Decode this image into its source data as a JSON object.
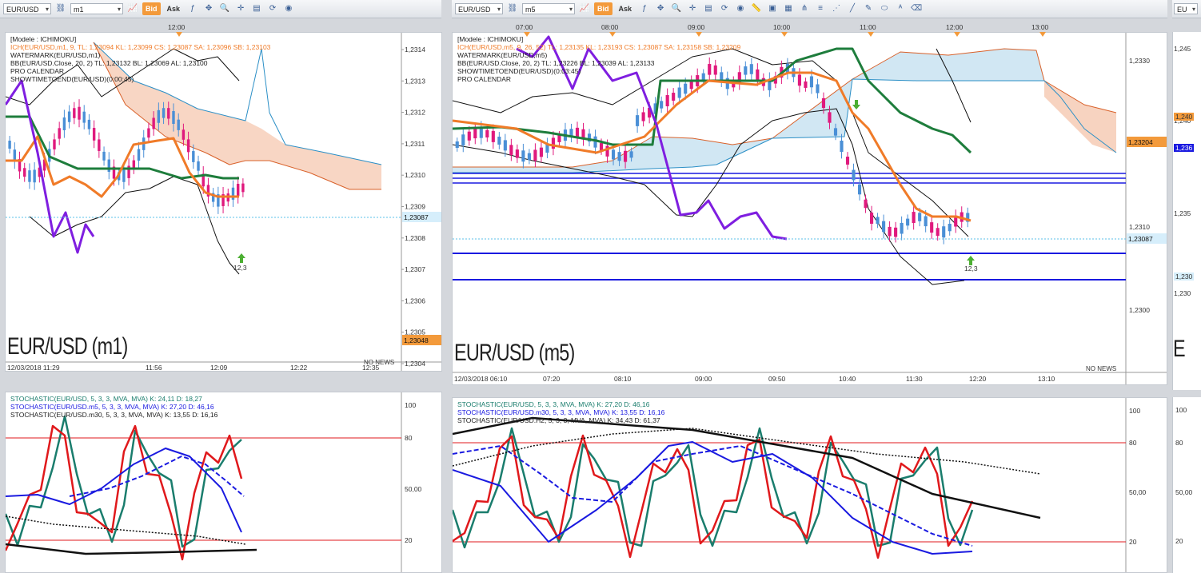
{
  "colors": {
    "accent": "#f39a3b",
    "bull": "#4a8fd6",
    "bear": "#e0197d",
    "tenkan": "#f07b28",
    "kijun": "#1e7d3c",
    "chikou": "#7f1ee0",
    "kumo_up": "#c5e1f0",
    "kumo_down": "#f5c8b0",
    "stoch_k": "#e0191c",
    "stoch_d": "#1a7d6d",
    "stoch_m5": "#1a1ae0"
  },
  "left": {
    "toolbar": {
      "symbol": "EUR/USD",
      "timeframe": "m1",
      "bid": "Bid",
      "ask": "Ask"
    },
    "legend": [
      {
        "text": "[Modele : ICHIMOKU]",
        "color": "#222"
      },
      {
        "text": "ICH(EUR/USD,m1, 9,  TL: 1,23094   KL: 1,23099   CS: 1,23087   SA: 1,23096   SB: 1,23103",
        "color": "#f07b28"
      },
      {
        "text": "WATERMARK(EUR/USD,m1)",
        "color": "#222"
      },
      {
        "text": "BB(EUR/USD.Close, 20, 2)  TL: 1,23132   BL: 1,23069   AL: 1,23100",
        "color": "#222"
      },
      {
        "text": "PRO CALENDAR",
        "color": "#222"
      },
      {
        "text": "SHOWTIMETOEND(EUR/USD)(0:00:45)",
        "color": "#222"
      }
    ],
    "watermark": "EUR/USD (m1)",
    "top_time": "12:00",
    "price_ticks": [
      "1,2314",
      "1,2313",
      "1,2312",
      "1,2311",
      "1,2310",
      "1,2309",
      "1,2308",
      "1,2307",
      "1,2306",
      "1,2305",
      "1,2304"
    ],
    "time_ticks": [
      "12/03/2018 11:29",
      "11:56",
      "12:09",
      "12:22",
      "12:35"
    ],
    "current_price": "1,23087",
    "level_price": "1,23048",
    "arrow_label": "12,3",
    "no_news": "NO NEWS",
    "stoch_legend": [
      {
        "text": "STOCHASTIC(EUR/USD, 5, 3, 3, MVA, MVA)   K: 24,11   D: 18,27",
        "color": "#1a7d6d"
      },
      {
        "text": "STOCHASTIC(EUR/USD.m5, 5, 3, 3, MVA, MVA)   K: 27,20   D: 46,16",
        "color": "#1a1ae0"
      },
      {
        "text": "STOCHASTIC(EUR/USD.m30, 5, 3, 3, MVA, MVA)   K: 13,55   D: 16,16",
        "color": "#222"
      }
    ],
    "stoch_ticks": [
      "100",
      "80",
      "50,00",
      "20"
    ]
  },
  "right": {
    "toolbar": {
      "symbol": "EUR/USD",
      "timeframe": "m5",
      "bid": "Bid",
      "ask": "Ask"
    },
    "legend": [
      {
        "text": "[Modele : ICHIMOKU]",
        "color": "#222"
      },
      {
        "text": "ICH(EUR/USD,m5, 9, 26, 52)  TL: 1,23135   KL: 1,23193   CS: 1,23087   SA: 1,23158   SB: 1,23209",
        "color": "#f07b28"
      },
      {
        "text": "WATERMARK(EUR/USD,m5)",
        "color": "#222"
      },
      {
        "text": "BB(EUR/USD.Close, 20, 2)  TL: 1,23226   BL: 1,23039   AL: 1,23133",
        "color": "#222"
      },
      {
        "text": "SHOWTIMETOEND(EUR/USD)(0:03:45)",
        "color": "#222"
      },
      {
        "text": "PRO CALENDAR",
        "color": "#222"
      }
    ],
    "watermark": "EUR/USD (m5)",
    "top_times": [
      "07:00",
      "08:00",
      "09:00",
      "10:00",
      "11:00",
      "12:00",
      "13:00"
    ],
    "price_ticks": [
      "1,2330",
      "1,2320",
      "1,2310",
      "1,2300"
    ],
    "time_ticks": [
      "12/03/2018 06:10",
      "07:20",
      "08:10",
      "09:00",
      "09:50",
      "10:40",
      "11:30",
      "12:20",
      "13:10"
    ],
    "current_price": "1,23087",
    "ichi_price": "1,23204",
    "arrow_label": "12,3",
    "no_news": "NO NEWS",
    "stoch_legend": [
      {
        "text": "STOCHASTIC(EUR/USD, 5, 3, 3, MVA, MVA)   K: 27,20   D: 46,16",
        "color": "#1a7d6d"
      },
      {
        "text": "STOCHASTIC(EUR/USD.m30, 5, 3, 3, MVA, MVA)   K: 13,55   D: 16,16",
        "color": "#1a1ae0"
      },
      {
        "text": "STOCHASTIC(EUR/USD.H2, 5, 3, 3, MVA, MVA)   K: 34,43   D: 61,37",
        "color": "#222"
      }
    ],
    "stoch_ticks": [
      "100",
      "80",
      "50,00",
      "20"
    ]
  },
  "far_right": {
    "symbol": "EU",
    "price_ticks": [
      "1,245",
      "1,240",
      "1,235",
      "1,230"
    ],
    "tags": [
      "1,240",
      "1,236",
      "1,230"
    ],
    "watermark": "E",
    "stoch_ticks": [
      "100",
      "80",
      "50,00",
      "20"
    ]
  }
}
